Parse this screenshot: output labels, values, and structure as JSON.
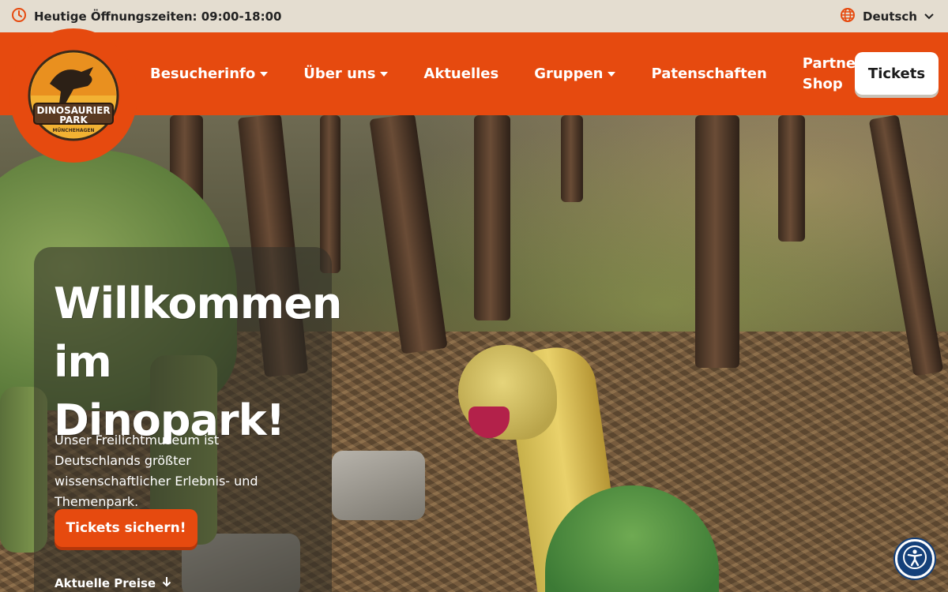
{
  "topbar": {
    "hours_text": "Heutige Öffnungszeiten: 09:00-18:00",
    "clock_icon": "clock-icon",
    "language": "Deutsch",
    "globe_icon": "globe-icon"
  },
  "nav": {
    "logo": {
      "line1": "DINOSAURIER",
      "line2": "PARK",
      "line3": "MÜNCHEHAGEN"
    },
    "items": [
      {
        "label": "Besucherinfo",
        "has_dropdown": true
      },
      {
        "label": "Über uns",
        "has_dropdown": true
      },
      {
        "label": "Aktuelles",
        "has_dropdown": false
      },
      {
        "label": "Gruppen",
        "has_dropdown": true
      },
      {
        "label": "Patenschaften",
        "has_dropdown": false
      },
      {
        "label": "Partner-Shop",
        "has_dropdown": false
      }
    ],
    "tickets_label": "Tickets"
  },
  "hero": {
    "headline_line1": "Willkommen",
    "headline_line2": "im Dinopark!",
    "subtitle": "Unser Freilichtmuseum ist Deutschlands größter wissenschaftlicher Erlebnis- und Themenpark.",
    "cta_label": "Tickets sichern!",
    "prices_link": "Aktuelle Preise"
  },
  "accessibility": {
    "icon": "accessibility-icon"
  },
  "colors": {
    "brand_orange": "#e64a0f",
    "topbar_bg": "#e4ddd0",
    "a11y_blue": "#14407a"
  }
}
